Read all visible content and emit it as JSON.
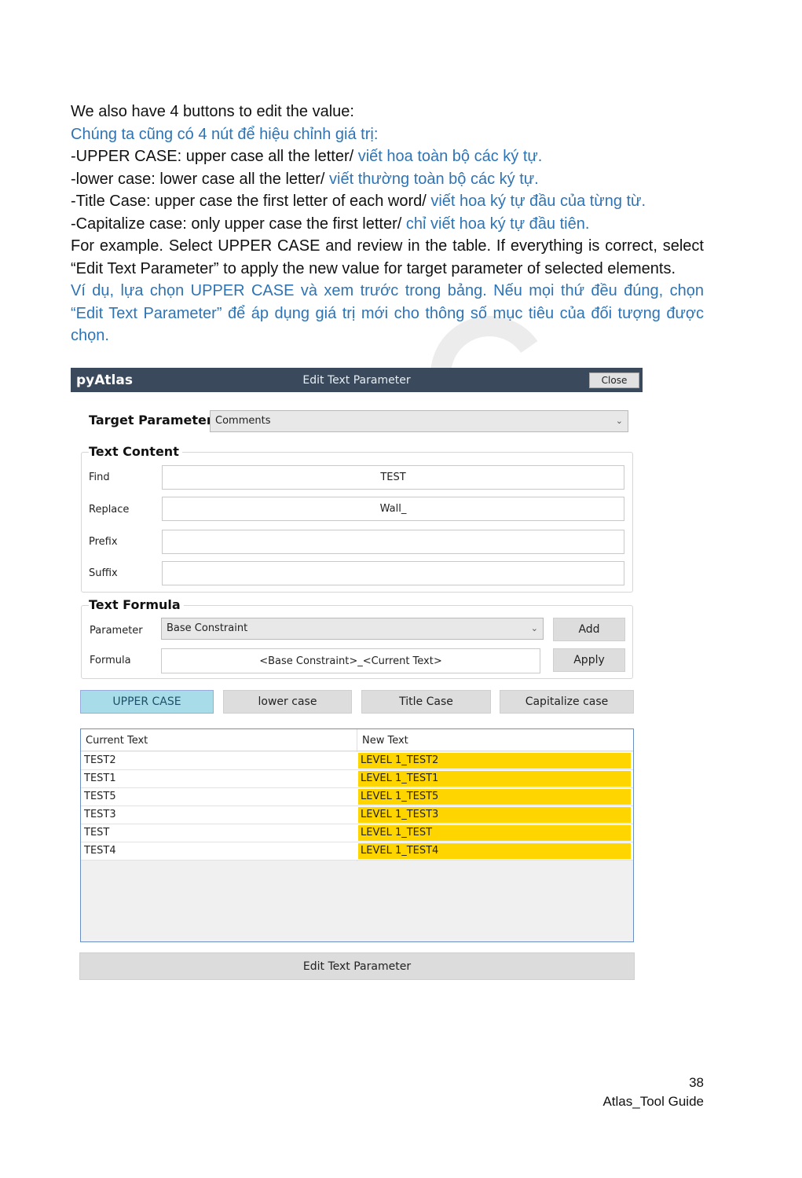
{
  "doc": {
    "line1": "We also have 4 buttons to edit the value:",
    "line1_vi": "Chúng ta cũng có 4 nút để hiệu chỉnh giá trị:",
    "upper_en": "-UPPER CASE: upper case all the letter/ ",
    "upper_vi": "viết hoa toàn bộ các ký tự.",
    "lower_en": "-lower case: lower case all the letter/ ",
    "lower_vi": "viết thường toàn bộ các ký tự.",
    "title_en": "-Title Case: upper case the first letter of each word/ ",
    "title_vi": "viết hoa ký tự đầu của từng từ.",
    "cap_en": "-Capitalize case: only upper case the first letter/ ",
    "cap_vi": "chỉ viết hoa ký tự đầu tiên.",
    "example_en": "For example. Select UPPER CASE and review in the table. If everything is correct, select “Edit Text Parameter” to apply the new value for target parameter of selected elements.",
    "example_vi": "Ví dụ, lựa chọn UPPER CASE và xem trước trong bảng. Nếu mọi thứ đều đúng, chọn “Edit Text Parameter” để áp dụng giá trị mới cho thông số mục tiêu của đối tượng được chọn."
  },
  "window": {
    "app_name": "pyAtlas",
    "title": "Edit Text Parameter",
    "close_label": "Close"
  },
  "target": {
    "label": "Target Parameter",
    "value": "Comments"
  },
  "text_content": {
    "heading": "Text Content",
    "find_label": "Find",
    "find_value": "TEST",
    "replace_label": "Replace",
    "replace_value": "Wall_",
    "prefix_label": "Prefix",
    "prefix_value": "",
    "suffix_label": "Suffix",
    "suffix_value": ""
  },
  "text_formula": {
    "heading": "Text Formula",
    "parameter_label": "Parameter",
    "parameter_value": "Base Constraint",
    "add_label": "Add",
    "formula_label": "Formula",
    "formula_value": "<Base Constraint>_<Current Text>",
    "apply_label": "Apply"
  },
  "case_buttons": {
    "upper": "UPPER CASE",
    "lower": "lower case",
    "title": "Title Case",
    "capitalize": "Capitalize case",
    "active": "upper"
  },
  "table": {
    "columns": [
      "Current Text",
      "New Text"
    ],
    "rows": [
      [
        "TEST2",
        "LEVEL 1_TEST2"
      ],
      [
        "TEST1",
        "LEVEL 1_TEST1"
      ],
      [
        "TEST5",
        "LEVEL 1_TEST5"
      ],
      [
        "TEST3",
        "LEVEL 1_TEST3"
      ],
      [
        "TEST",
        "LEVEL 1_TEST"
      ],
      [
        "TEST4",
        "LEVEL 1_TEST4"
      ]
    ],
    "highlight_color": "#ffd500"
  },
  "footer_button": "Edit Text Parameter",
  "page": {
    "number": "38",
    "guide": "Atlas_Tool Guide"
  },
  "colors": {
    "vietnamese_text": "#2e74b5",
    "titlebar": "#3a4a5c",
    "active_button": "#a8dce8"
  }
}
